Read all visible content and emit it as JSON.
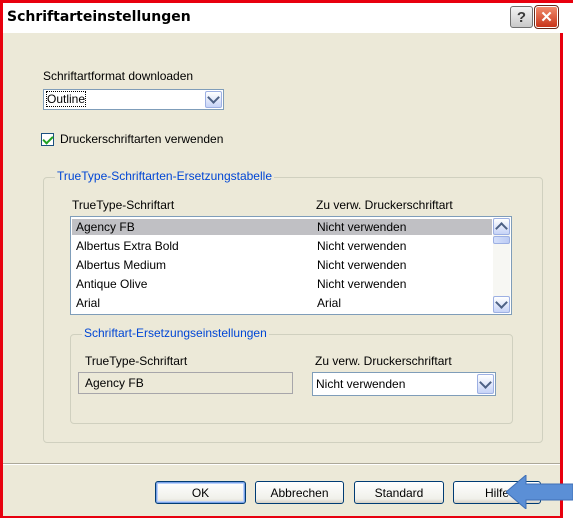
{
  "window": {
    "title": "Schriftarteinstellungen"
  },
  "titlebar": {
    "help_label": "?",
    "close_label": "✕"
  },
  "download_format": {
    "label": "Schriftartformat downloaden",
    "value": "Outline"
  },
  "printer_fonts": {
    "label": "Druckerschriftarten verwenden",
    "checked": true
  },
  "substitution_table": {
    "group_title": "TrueType-Schriftarten-Ersetzungstabelle",
    "col_truetype": "TrueType-Schriftart",
    "col_printer": "Zu verw. Druckerschriftart",
    "rows": [
      {
        "truetype": "Agency FB",
        "printer": "Nicht verwenden",
        "selected": true
      },
      {
        "truetype": "Albertus Extra Bold",
        "printer": "Nicht verwenden"
      },
      {
        "truetype": "Albertus Medium",
        "printer": "Nicht verwenden"
      },
      {
        "truetype": "Antique Olive",
        "printer": "Nicht verwenden"
      },
      {
        "truetype": "Arial",
        "printer": "Arial"
      }
    ]
  },
  "substitution_settings": {
    "group_title": "Schriftart-Ersetzungseinstellungen",
    "truetype_label": "TrueType-Schriftart",
    "truetype_value": "Agency FB",
    "printer_label": "Zu verw. Druckerschriftart",
    "printer_value": "Nicht verwenden"
  },
  "buttons": {
    "ok": "OK",
    "cancel": "Abbrechen",
    "standard": "Standard",
    "help": "Hilfe"
  },
  "colors": {
    "highlight_frame": "#e8000e",
    "group_title": "#0046d5",
    "pointer_arrow": "#5b8fd6"
  },
  "icons": {
    "dropdown": "chevron-down-icon",
    "scroll_up": "chevron-up-icon",
    "checkbox": "check-icon",
    "pointer": "arrow-left-icon"
  }
}
